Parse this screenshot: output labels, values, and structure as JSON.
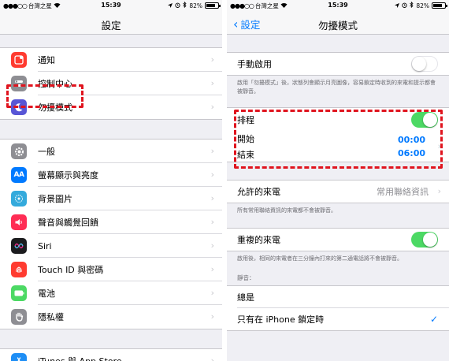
{
  "status_bar": {
    "carrier": "台灣之星",
    "signal_dots": "●●●○○",
    "time": "15:39",
    "battery": "82%",
    "battery_level": 0.82
  },
  "left": {
    "nav_title": "設定",
    "groups": [
      [
        {
          "label": "通知",
          "icon": "notifications-icon",
          "color": "#ff3b30"
        },
        {
          "label": "控制中心",
          "icon": "control-center-icon",
          "color": "#8e8e93"
        },
        {
          "label": "勿擾模式",
          "icon": "moon-icon",
          "color": "#5856d6"
        }
      ],
      [
        {
          "label": "一般",
          "icon": "gear-icon",
          "color": "#8e8e93"
        },
        {
          "label": "螢幕顯示與亮度",
          "icon": "display-icon",
          "color": "#007aff"
        },
        {
          "label": "背景圖片",
          "icon": "wallpaper-icon",
          "color": "#34aadc"
        },
        {
          "label": "聲音與觸覺回饋",
          "icon": "sound-icon",
          "color": "#ff2d55"
        },
        {
          "label": "Siri",
          "icon": "siri-icon",
          "color": "#1c1c1e"
        },
        {
          "label": "Touch ID 與密碼",
          "icon": "fingerprint-icon",
          "color": "#ff3b30"
        },
        {
          "label": "電池",
          "icon": "battery-icon",
          "color": "#4cd964"
        },
        {
          "label": "隱私權",
          "icon": "hand-icon",
          "color": "#8e8e93"
        }
      ],
      [
        {
          "label": "iTunes 與 App Store",
          "icon": "app-store-icon",
          "color": "#1e8ef5"
        }
      ]
    ]
  },
  "right": {
    "back_label": "設定",
    "nav_title": "勿擾模式",
    "manual_label": "手動啟用",
    "manual_on": false,
    "manual_note": "啟用「勿擾模式」後，狀態列會顯示月亮圖像，容易鎖定時收到的來電和提示都會被靜音。",
    "scheduled_label": "排程",
    "scheduled_on": true,
    "from_label": "開始",
    "from_value": "00:00",
    "to_label": "結束",
    "to_value": "06:00",
    "allow_calls_label": "允許的來電",
    "allow_calls_value": "常用聯絡資訊",
    "allow_calls_note": "所有常用聯絡資訊的來電都不會被靜音。",
    "repeated_label": "重複的來電",
    "repeated_on": true,
    "repeated_note": "啟用後，相同的來電者在三分鐘內打來的第二通電話將不會被靜音。",
    "silence_header": "靜音：",
    "silence_always": "總是",
    "silence_locked": "只有在 iPhone 鎖定時",
    "checkmark": "✓"
  },
  "colors": {
    "accent": "#007aff",
    "switch_on": "#4cd964",
    "highlight": "#e0141e"
  }
}
